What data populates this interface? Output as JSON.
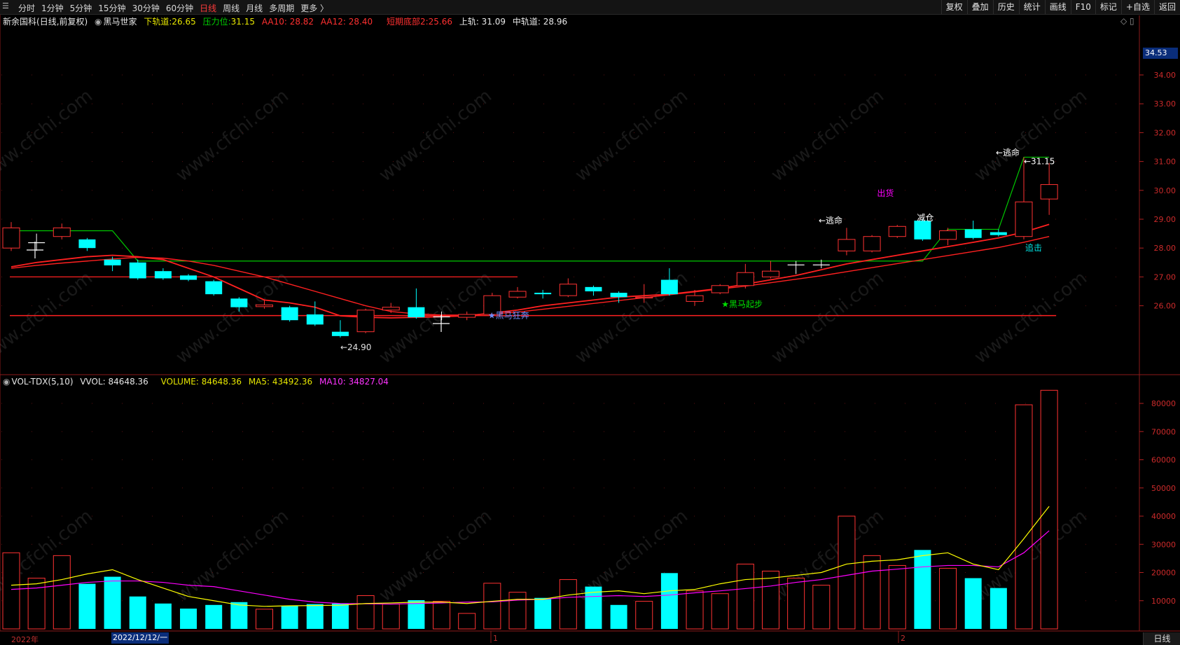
{
  "toolbar": {
    "periods": [
      "分时",
      "1分钟",
      "5分钟",
      "15分钟",
      "30分钟",
      "60分钟",
      "日线",
      "周线",
      "月线",
      "多周期",
      "更多 〉"
    ],
    "active_period": "日线",
    "right_tools": [
      "复权",
      "叠加",
      "历史",
      "统计",
      "画线",
      "F10",
      "标记",
      "+自选",
      "返回"
    ]
  },
  "info": {
    "stock": "新余国科",
    "mode": "(日线,前复权)",
    "indicator": "黑马世家",
    "lower_rail_label": "下轨道:",
    "lower_rail_value": "26.65",
    "pressure_label": "压力位:",
    "pressure_value": "31.15",
    "aa10": "AA10: 28.82",
    "aa12": "AA12: 28.40",
    "short_bottom_label": "短期底部2:",
    "short_bottom_value": "25.66",
    "upper_rail": "上轨: 31.09",
    "mid_rail": "中轨道: 28.96"
  },
  "volume_info": {
    "name": "VOL-TDX(5,10)",
    "vvol": "VVOL: 84648.36",
    "volume": "VOLUME: 84648.36",
    "ma5": "MA5: 43492.36",
    "ma10": "MA10: 34827.04"
  },
  "price_box": "34.53",
  "date_labels": {
    "year": "2022年",
    "m1": "1",
    "m2": "2"
  },
  "selected_date": "2022/12/12/一",
  "bottom_right": "日线",
  "watermark": "www.cfchi.com",
  "colors": {
    "up": "#ff3232",
    "down": "#00ffff",
    "ma_red": "#ff2020",
    "green": "#00c800",
    "yellow": "#ffff00",
    "magenta": "#ff00ff"
  },
  "chart_data": {
    "type": "candlestick",
    "price_axis": {
      "ticks": [
        34.0,
        33.0,
        32.0,
        31.0,
        30.0,
        29.0,
        28.0,
        27.0,
        26.0
      ],
      "range": [
        24.5,
        35.0
      ]
    },
    "volume_axis": {
      "ticks": [
        80000,
        70000,
        60000,
        50000,
        40000,
        30000,
        20000,
        10000
      ],
      "range": [
        0,
        88000
      ]
    },
    "candles": [
      {
        "o": 28.0,
        "c": 28.7,
        "h": 28.9,
        "l": 27.9
      },
      {
        "o": 28.2,
        "c": 28.2,
        "h": 28.5,
        "l": 27.9
      },
      {
        "o": 28.4,
        "c": 28.7,
        "h": 28.85,
        "l": 28.3
      },
      {
        "o": 28.3,
        "c": 28.0,
        "h": 28.35,
        "l": 27.9
      },
      {
        "o": 27.6,
        "c": 27.4,
        "h": 27.7,
        "l": 27.2
      },
      {
        "o": 27.5,
        "c": 26.95,
        "h": 27.6,
        "l": 26.9
      },
      {
        "o": 27.2,
        "c": 26.95,
        "h": 27.3,
        "l": 26.9
      },
      {
        "o": 27.05,
        "c": 26.9,
        "h": 27.1,
        "l": 26.85
      },
      {
        "o": 26.85,
        "c": 26.4,
        "h": 26.9,
        "l": 26.35
      },
      {
        "o": 26.25,
        "c": 25.95,
        "h": 26.3,
        "l": 25.8
      },
      {
        "o": 25.97,
        "c": 26.03,
        "h": 26.2,
        "l": 25.9
      },
      {
        "o": 25.95,
        "c": 25.5,
        "h": 26.0,
        "l": 25.45
      },
      {
        "o": 25.7,
        "c": 25.35,
        "h": 26.15,
        "l": 25.3
      },
      {
        "o": 25.1,
        "c": 24.95,
        "h": 25.5,
        "l": 24.9
      },
      {
        "o": 25.1,
        "c": 25.85,
        "h": 25.9,
        "l": 25.05
      },
      {
        "o": 25.85,
        "c": 25.95,
        "h": 26.1,
        "l": 25.75
      },
      {
        "o": 25.95,
        "c": 25.6,
        "h": 26.6,
        "l": 25.55
      },
      {
        "o": 25.63,
        "c": 25.63,
        "h": 25.8,
        "l": 25.5
      },
      {
        "o": 25.6,
        "c": 25.7,
        "h": 25.8,
        "l": 25.5
      },
      {
        "o": 25.7,
        "c": 26.35,
        "h": 26.45,
        "l": 25.6
      },
      {
        "o": 26.3,
        "c": 26.5,
        "h": 26.65,
        "l": 26.25
      },
      {
        "o": 26.45,
        "c": 26.4,
        "h": 26.55,
        "l": 26.25
      },
      {
        "o": 26.35,
        "c": 26.75,
        "h": 26.95,
        "l": 26.3
      },
      {
        "o": 26.65,
        "c": 26.5,
        "h": 26.7,
        "l": 26.35
      },
      {
        "o": 26.45,
        "c": 26.3,
        "h": 26.5,
        "l": 26.1
      },
      {
        "o": 26.27,
        "c": 26.3,
        "h": 26.75,
        "l": 26.1
      },
      {
        "o": 26.9,
        "c": 26.4,
        "h": 27.3,
        "l": 26.35
      },
      {
        "o": 26.15,
        "c": 26.35,
        "h": 26.55,
        "l": 26.0
      },
      {
        "o": 26.45,
        "c": 26.7,
        "h": 26.75,
        "l": 26.4
      },
      {
        "o": 26.7,
        "c": 27.15,
        "h": 27.45,
        "l": 26.6
      },
      {
        "o": 27.0,
        "c": 27.2,
        "h": 27.55,
        "l": 26.95
      },
      {
        "o": 27.43,
        "c": 27.43,
        "h": 27.55,
        "l": 27.1
      },
      {
        "o": 27.43,
        "c": 27.43,
        "h": 27.6,
        "l": 27.3
      },
      {
        "o": 27.9,
        "c": 28.3,
        "h": 28.7,
        "l": 27.75
      },
      {
        "o": 27.9,
        "c": 28.4,
        "h": 28.45,
        "l": 27.85
      },
      {
        "o": 28.4,
        "c": 28.75,
        "h": 28.8,
        "l": 28.35
      },
      {
        "o": 28.95,
        "c": 28.3,
        "h": 29.0,
        "l": 28.25
      },
      {
        "o": 28.3,
        "c": 28.6,
        "h": 28.7,
        "l": 28.1
      },
      {
        "o": 28.65,
        "c": 28.35,
        "h": 28.95,
        "l": 28.3
      },
      {
        "o": 28.55,
        "c": 28.45,
        "h": 28.65,
        "l": 28.4
      },
      {
        "o": 28.4,
        "c": 29.6,
        "h": 31.15,
        "l": 28.3
      },
      {
        "o": 29.7,
        "c": 30.2,
        "h": 30.95,
        "l": 29.15
      }
    ],
    "ma_short": [
      27.35,
      27.5,
      27.6,
      27.7,
      27.75,
      27.7,
      27.6,
      27.3,
      27.0,
      26.6,
      26.2,
      26.1,
      25.95,
      25.65,
      25.6,
      25.58,
      25.6,
      25.62,
      25.65,
      25.75,
      25.85,
      26.0,
      26.1,
      26.2,
      26.3,
      26.35,
      26.4,
      26.5,
      26.6,
      26.75,
      26.9,
      27.05,
      27.25,
      27.45,
      27.6,
      27.75,
      27.9,
      28.05,
      28.2,
      28.35,
      28.55,
      28.82
    ],
    "ma_long": [
      27.3,
      27.4,
      27.48,
      27.55,
      27.62,
      27.68,
      27.65,
      27.55,
      27.4,
      27.2,
      27.0,
      26.75,
      26.5,
      26.25,
      26.0,
      25.8,
      25.72,
      25.68,
      25.68,
      25.72,
      25.78,
      25.88,
      25.98,
      26.08,
      26.18,
      26.28,
      26.38,
      26.48,
      26.58,
      26.68,
      26.8,
      26.92,
      27.04,
      27.18,
      27.32,
      27.46,
      27.6,
      27.74,
      27.88,
      28.02,
      28.2,
      28.4
    ],
    "upper_band": [
      28.6,
      28.6,
      28.6,
      28.6,
      28.6,
      27.55,
      27.55,
      27.55,
      27.55,
      27.55,
      27.55,
      27.55,
      27.55,
      27.55,
      27.55,
      27.55,
      27.55,
      27.55,
      27.55,
      27.55,
      27.55,
      27.55,
      27.55,
      27.55,
      27.55,
      27.55,
      27.55,
      27.55,
      27.55,
      27.55,
      27.55,
      27.55,
      27.55,
      27.55,
      27.55,
      27.55,
      27.55,
      28.65,
      28.65,
      28.65,
      31.15,
      31.15
    ],
    "bottom_line": 25.66,
    "flat_red_line": 27.0,
    "annotations": [
      {
        "text": "←24.90",
        "i": 13,
        "price": 24.9
      },
      {
        "text": "★黑马狂奔",
        "i": 19,
        "price": 25.66
      },
      {
        "text": "★黑马起步",
        "i": 28,
        "price": 26.05
      },
      {
        "text": "←逃命",
        "i": 33,
        "price": 28.95
      },
      {
        "text": "减仓",
        "i": 36,
        "price": 29.05
      },
      {
        "text": "出货",
        "i": 36,
        "price": 29.9
      },
      {
        "text": "←逃命",
        "i": 40,
        "price": 31.3
      },
      {
        "text": "←31.15",
        "i": 40,
        "price": 31.0
      },
      {
        "text": "追击",
        "i": 40,
        "price": 28.0
      }
    ],
    "volume": [
      27000,
      18000,
      26000,
      16000,
      18500,
      11500,
      9000,
      7200,
      8500,
      9500,
      7000,
      8200,
      8800,
      9000,
      11800,
      8800,
      10200,
      9800,
      5500,
      16200,
      13000,
      11000,
      17500,
      15000,
      8500,
      9800,
      19800,
      13500,
      12500,
      23000,
      20500,
      18000,
      15500,
      40000,
      26000,
      22500,
      28000,
      21500,
      18000,
      14500,
      79500,
      84648
    ],
    "vol_ma5": [
      15500,
      16000,
      17500,
      19500,
      21000,
      17500,
      14500,
      11500,
      10000,
      8500,
      8000,
      8200,
      8300,
      8400,
      9000,
      9200,
      9500,
      9500,
      9000,
      9800,
      10500,
      10500,
      12000,
      13000,
      13500,
      12500,
      13500,
      14000,
      16000,
      17500,
      18000,
      19000,
      20000,
      23000,
      24000,
      24500,
      26000,
      27000,
      23000,
      21000,
      32000,
      43492
    ],
    "vol_ma10": [
      14000,
      14500,
      15500,
      16500,
      17000,
      17000,
      16500,
      15500,
      15000,
      13500,
      12000,
      10500,
      9500,
      9000,
      8900,
      8800,
      9000,
      9200,
      9500,
      9600,
      10200,
      10500,
      11200,
      11500,
      11800,
      11500,
      12000,
      12800,
      13500,
      14300,
      15200,
      16500,
      17500,
      19000,
      20500,
      21200,
      22000,
      22500,
      22500,
      22000,
      27000,
      34827
    ]
  }
}
